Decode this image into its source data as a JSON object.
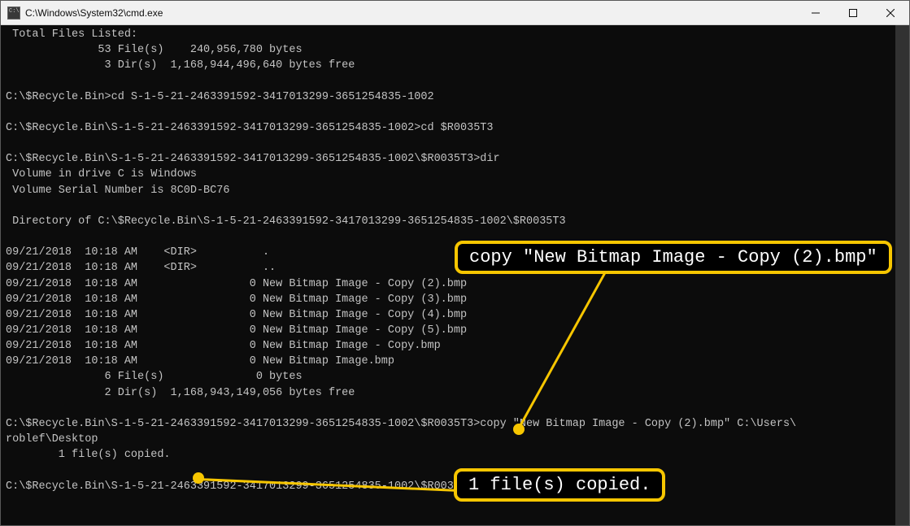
{
  "window": {
    "title": "C:\\Windows\\System32\\cmd.exe"
  },
  "callouts": {
    "copy_cmd": "copy \"New Bitmap Image - Copy (2).bmp\"",
    "copied_msg": "1 file(s) copied."
  },
  "terminal": {
    "l01": " Total Files Listed:",
    "l02": "              53 File(s)    240,956,780 bytes",
    "l03": "               3 Dir(s)  1,168,944,496,640 bytes free",
    "l04": "",
    "l05": "C:\\$Recycle.Bin>cd S-1-5-21-2463391592-3417013299-3651254835-1002",
    "l06": "",
    "l07": "C:\\$Recycle.Bin\\S-1-5-21-2463391592-3417013299-3651254835-1002>cd $R0035T3",
    "l08": "",
    "l09": "C:\\$Recycle.Bin\\S-1-5-21-2463391592-3417013299-3651254835-1002\\$R0035T3>dir",
    "l10": " Volume in drive C is Windows",
    "l11": " Volume Serial Number is 8C0D-BC76",
    "l12": "",
    "l13": " Directory of C:\\$Recycle.Bin\\S-1-5-21-2463391592-3417013299-3651254835-1002\\$R0035T3",
    "l14": "",
    "l15": "09/21/2018  10:18 AM    <DIR>          .",
    "l16": "09/21/2018  10:18 AM    <DIR>          ..",
    "l17": "09/21/2018  10:18 AM                 0 New Bitmap Image - Copy (2).bmp",
    "l18": "09/21/2018  10:18 AM                 0 New Bitmap Image - Copy (3).bmp",
    "l19": "09/21/2018  10:18 AM                 0 New Bitmap Image - Copy (4).bmp",
    "l20": "09/21/2018  10:18 AM                 0 New Bitmap Image - Copy (5).bmp",
    "l21": "09/21/2018  10:18 AM                 0 New Bitmap Image - Copy.bmp",
    "l22": "09/21/2018  10:18 AM                 0 New Bitmap Image.bmp",
    "l23": "               6 File(s)              0 bytes",
    "l24": "               2 Dir(s)  1,168,943,149,056 bytes free",
    "l25": "",
    "l26": "C:\\$Recycle.Bin\\S-1-5-21-2463391592-3417013299-3651254835-1002\\$R0035T3>copy \"New Bitmap Image - Copy (2).bmp\" C:\\Users\\",
    "l27": "roblef\\Desktop",
    "l28": "        1 file(s) copied.",
    "l29": "",
    "l30": "C:\\$Recycle.Bin\\S-1-5-21-2463391592-3417013299-3651254835-1002\\$R0035T3>"
  }
}
